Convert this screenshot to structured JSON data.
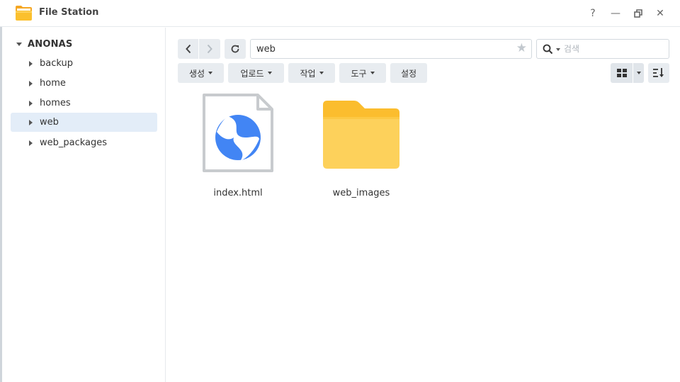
{
  "window": {
    "title": "File Station",
    "help_glyph": "?",
    "minimize_glyph": "—",
    "restore_glyph": "❐",
    "close_glyph": "✕"
  },
  "sidebar": {
    "root_label": "ANONAS",
    "items": [
      {
        "label": "backup",
        "selected": false
      },
      {
        "label": "home",
        "selected": false
      },
      {
        "label": "homes",
        "selected": false
      },
      {
        "label": "web",
        "selected": true
      },
      {
        "label": "web_packages",
        "selected": false
      }
    ]
  },
  "toolbar": {
    "path": "web",
    "search_placeholder": "검색",
    "create_label": "생성",
    "upload_label": "업로드",
    "action_label": "작업",
    "tools_label": "도구",
    "settings_label": "설정"
  },
  "files": [
    {
      "name": "index.html",
      "icon": "html-file-icon"
    },
    {
      "name": "web_images",
      "icon": "folder-icon"
    }
  ],
  "colors": {
    "accent": "#4285f4",
    "folder": "#fbc02d",
    "folder_light": "#fdd15b",
    "selected_bg": "#e3edf8",
    "button_bg": "#e8ecf0"
  }
}
